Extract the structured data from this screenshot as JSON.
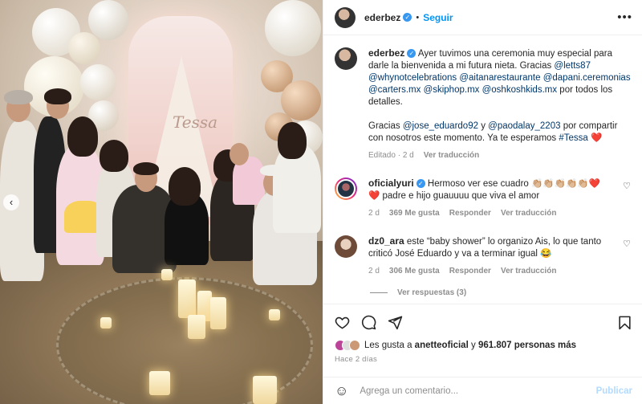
{
  "post": {
    "author": "ederbez",
    "follow_label": "Seguir",
    "separator": "•",
    "caption_pre": "Ayer tuvimos una ceremonia muy especial para darle la bienvenida a mi futura nieta. Gracias",
    "caption_mentions": [
      "@letts87",
      "@whynotcelebrations",
      "@aitanarestaurante",
      "@dapani.ceremonias",
      "@carters.mx",
      "@skiphop.mx",
      "@oshkoshkids.mx"
    ],
    "caption_mid": "por todos los detalles.",
    "caption2_pre": "Gracias",
    "caption2_mention1": "@jose_eduardo92",
    "caption2_and": "y",
    "caption2_mention2": "@paodalay_2203",
    "caption2_post": "por compartir con nosotros este momento. Ya te esperamos",
    "caption2_hashtag": "#Tessa",
    "edited_label": "Editado",
    "time": "2 d",
    "translate_label": "Ver traducción"
  },
  "comments": [
    {
      "user": "oficialyuri",
      "verified": true,
      "text": "Hermoso ver ese cuadro 👏🏼👏🏼👏🏼👏🏼👏🏼❤️❤️ padre e hijo guauuuu que viva el amor",
      "time": "2 d",
      "likes": "369 Me gusta",
      "reply": "Responder",
      "translate": "Ver traducción"
    },
    {
      "user": "dz0_ara",
      "verified": false,
      "text": "este “baby shower” lo organizo Ais, lo que tanto criticó José Eduardo y va a terminar igual 😂",
      "time": "2 d",
      "likes": "306 Me gusta",
      "reply": "Responder",
      "translate": "Ver traducción",
      "view_replies": "Ver respuestas (3)"
    }
  ],
  "likes": {
    "prefix": "Les gusta a",
    "user": "anetteoficial",
    "connector": "y",
    "count": "961.807 personas más"
  },
  "time_ago": "Hace 2 días",
  "add_comment": {
    "placeholder": "Agrega un comentario...",
    "publish": "Publicar"
  },
  "photo": {
    "sign_text": "Tessa"
  },
  "colors": {
    "accent": "#0095f6",
    "verified": "#3897f0",
    "text": "#262626",
    "muted": "#8e8e8e",
    "link": "#00376b",
    "heart": "#ed4956"
  }
}
